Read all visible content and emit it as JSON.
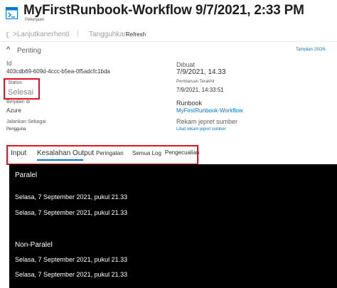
{
  "header": {
    "title": "MyFirstRunbook-Workflow 9/7/2021, 2:33 PM",
    "more_glyph": "···",
    "subtitle": "Pekerjaan"
  },
  "toolbar": {
    "resume_label": ">Lanjutkan",
    "stop_label": "erhenti",
    "sep": "|",
    "suspend_label": "Tangguhkan",
    "refresh_label": "Refresh"
  },
  "essentials": {
    "toggle_glyph": "^",
    "label": "Penting",
    "json_view_link": "Tampilan JSON"
  },
  "fields": {
    "id_label": "Id",
    "id_value": "403cdb69-609d-4ccc-b5ea-0f5adcfc1bda",
    "status_label": "Status",
    "status_value": "Selesai",
    "ran_on_label": "Berjalan di",
    "ran_on_value": "Azure",
    "run_as_label": "Jalankan Sebagai",
    "run_as_value": "Pengguna",
    "created_label": "Dibuat",
    "created_value": "7/9/2021, 14.33",
    "last_updated_label": "Pembaruan Terakhir",
    "last_updated_value": "7/9/2021, 14:33:51",
    "runbook_label": "Runbook",
    "runbook_value": "MyFirstRunbook-Workflow",
    "snapshot_label": "Rekam jepret sumber",
    "snapshot_link": "Lihat rekam jepret sumber"
  },
  "tabs": {
    "input": "Input",
    "errors": "Kesalahan Output",
    "warnings": "Peringatan",
    "all_logs": "Semua Log",
    "exception": "Pengecualian"
  },
  "output": {
    "heading_parallel": "Paralel",
    "line1": "Selasa, 7 September 2021, pukul 21.33",
    "line2": "Selasa, 7 September 2021, pukul 21.33",
    "heading_nonparallel": "Non-Paralel",
    "line3": "Selasa, 7 September 2021, pukul 21.33",
    "line4": "Selasa, 7 September 2021, pukul 21.33"
  },
  "colors": {
    "accent": "#0078d4",
    "highlight_border": "#e81123",
    "console_bg": "#000000"
  }
}
